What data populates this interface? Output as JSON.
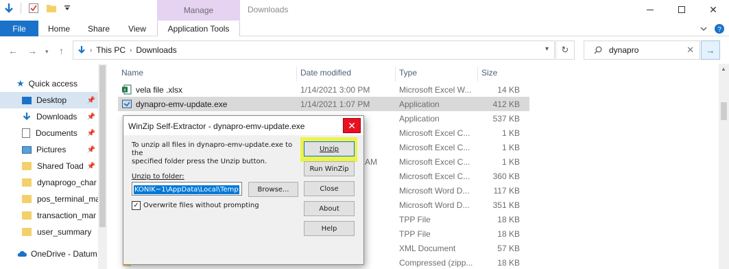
{
  "window": {
    "title": "Downloads",
    "context_group": "Manage",
    "buttons": {
      "minimize": "minimize-icon",
      "maximize": "maximize-icon",
      "close": "✕"
    }
  },
  "ribbon": {
    "tabs": [
      "File",
      "Home",
      "Share",
      "View",
      "Application Tools"
    ]
  },
  "address": {
    "crumbs": [
      "This PC",
      "Downloads"
    ],
    "search_value": "dynapro"
  },
  "nav": {
    "items": [
      {
        "label": "Quick access"
      },
      {
        "label": "Desktop"
      },
      {
        "label": "Downloads"
      },
      {
        "label": "Documents"
      },
      {
        "label": "Pictures"
      },
      {
        "label": "Shared Toad"
      },
      {
        "label": "dynaprogo_char"
      },
      {
        "label": "pos_terminal_ma"
      },
      {
        "label": "transaction_mar"
      },
      {
        "label": "user_summary"
      },
      {
        "label": "OneDrive - Datum"
      }
    ]
  },
  "files": {
    "columns": {
      "name": "Name",
      "date": "Date modified",
      "type": "Type",
      "size": "Size"
    },
    "rows": [
      {
        "name": "vela file .xlsx",
        "date": "1/14/2021 3:00 PM",
        "type": "Microsoft Excel W...",
        "size": "14 KB"
      },
      {
        "name": "dynapro-emv-update.exe",
        "date": "1/14/2021 1:07 PM",
        "type": "Application",
        "size": "412 KB"
      },
      {
        "name": "",
        "date": "",
        "type": "Application",
        "size": "537 KB"
      },
      {
        "name": "",
        "date": "",
        "type": "Microsoft Excel C...",
        "size": "1 KB"
      },
      {
        "name": "",
        "date": "",
        "type": "Microsoft Excel C...",
        "size": "1 KB"
      },
      {
        "name": "",
        "date": "AM",
        "type": "Microsoft Excel C...",
        "size": "1 KB"
      },
      {
        "name": "",
        "date": "",
        "type": "Microsoft Excel C...",
        "size": "360 KB"
      },
      {
        "name": "",
        "date": "",
        "type": "Microsoft Word D...",
        "size": "117 KB"
      },
      {
        "name": "",
        "date": "",
        "type": "Microsoft Word D...",
        "size": "351 KB"
      },
      {
        "name": "",
        "date": "",
        "type": "TPP File",
        "size": "18 KB"
      },
      {
        "name": "",
        "date": "",
        "type": "TPP File",
        "size": "18 KB"
      },
      {
        "name": "",
        "date": "",
        "type": "XML Document",
        "size": "57 KB"
      },
      {
        "name": "",
        "date": "",
        "type": "Compressed (zipp...",
        "size": "18 KB"
      }
    ]
  },
  "dialog": {
    "title": "WinZip Self-Extractor - dynapro-emv-update.exe",
    "close": "✕",
    "message_line1": "To unzip all files in dynapro-emv-update.exe to the",
    "message_line2": "specified folder press the Unzip button.",
    "folder_label": "Unzip to folder:",
    "folder_value": "KONIK~1\\AppData\\Local\\Temp",
    "browse": "Browse...",
    "overwrite": "Overwrite files without prompting",
    "overwrite_checked": "✓",
    "buttons": {
      "unzip": "Unzip",
      "run_winzip": "Run WinZip",
      "close": "Close",
      "about": "About",
      "help": "Help"
    },
    "highlight_color": "#eef34a"
  },
  "colors": {
    "accent": "#1a73c8",
    "manage_context": "#e6d3f2",
    "selection": "#d9d9d9"
  }
}
